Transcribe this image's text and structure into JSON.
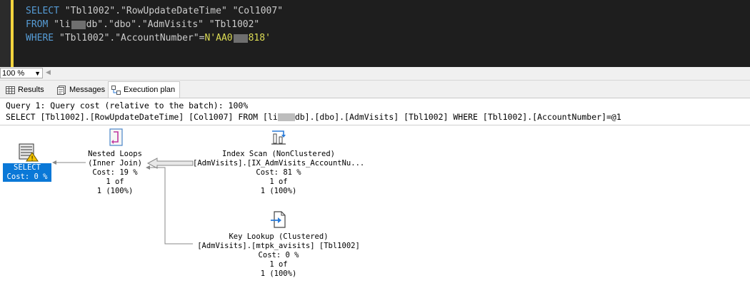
{
  "editor": {
    "line1": {
      "kw": "SELECT",
      "rest": " \"Tbl1002\".\"RowUpdateDateTime\" \"Col1007\""
    },
    "line2": {
      "kw": "FROM",
      "pre": " \"li",
      "post": "db\".\"dbo\".\"AdmVisits\" \"Tbl1002\""
    },
    "line3": {
      "kw": "WHERE",
      "mid": " \"Tbl1002\".\"AccountNumber\"=",
      "lit_pre": "N'AA0",
      "lit_post": "818'"
    }
  },
  "status": {
    "zoom": "100 %"
  },
  "tabs": [
    {
      "label": "Results"
    },
    {
      "label": "Messages"
    },
    {
      "label": "Execution plan"
    }
  ],
  "plan": {
    "query_line": "Query 1: Query cost (relative to the batch): 100%",
    "statement_pre": "SELECT [Tbl1002].[RowUpdateDateTime] [Col1007] FROM [li",
    "statement_post": "db].[dbo].[AdmVisits] [Tbl1002] WHERE [Tbl1002].[AccountNumber]=@1",
    "select": {
      "label": "SELECT",
      "cost": "Cost: 0 %"
    },
    "nested_loops": {
      "name": "Nested Loops",
      "sub": "(Inner Join)",
      "cost": "Cost: 19 %",
      "rows1": "1 of",
      "rows2": "1 (100%)"
    },
    "index_scan": {
      "name": "Index Scan (NonClustered)",
      "sub": "[AdmVisits].[IX_AdmVisits_AccountNu...",
      "cost": "Cost: 81 %",
      "rows1": "1 of",
      "rows2": "1 (100%)"
    },
    "key_lookup": {
      "name": "Key Lookup (Clustered)",
      "sub": "[AdmVisits].[mtpk_avisits] [Tbl1002]",
      "cost": "Cost: 0 %",
      "rows1": "1 of",
      "rows2": "1 (100%)"
    }
  }
}
